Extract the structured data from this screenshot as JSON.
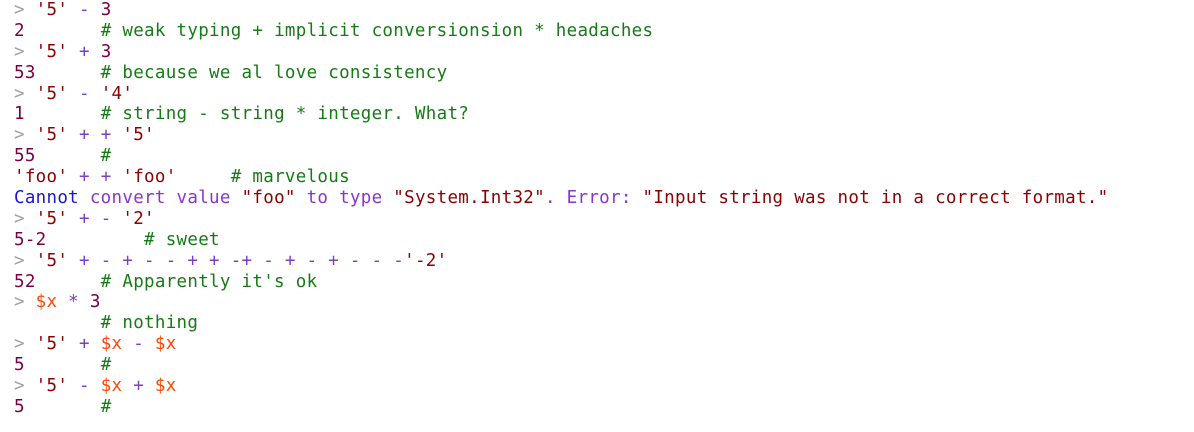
{
  "console": {
    "lines": [
      [
        {
          "t": "> ",
          "c": "prompt"
        },
        {
          "t": "'5'",
          "c": "str"
        },
        {
          "t": " - ",
          "c": "op"
        },
        {
          "t": "3",
          "c": "num"
        }
      ],
      [
        {
          "t": "2",
          "c": "num"
        },
        {
          "t": "       # weak typing + implicit conversionsion * headaches",
          "c": "cmt"
        }
      ],
      [
        {
          "t": "> ",
          "c": "prompt"
        },
        {
          "t": "'5'",
          "c": "str"
        },
        {
          "t": " + ",
          "c": "op"
        },
        {
          "t": "3",
          "c": "num"
        }
      ],
      [
        {
          "t": "53",
          "c": "num"
        },
        {
          "t": "      # because we al love consistency",
          "c": "cmt"
        }
      ],
      [
        {
          "t": "> ",
          "c": "prompt"
        },
        {
          "t": "'5'",
          "c": "str"
        },
        {
          "t": " - ",
          "c": "op"
        },
        {
          "t": "'4'",
          "c": "str"
        }
      ],
      [
        {
          "t": "1",
          "c": "num"
        },
        {
          "t": "       # string - string * integer. What?",
          "c": "cmt"
        }
      ],
      [
        {
          "t": "> ",
          "c": "prompt"
        },
        {
          "t": "'5'",
          "c": "str"
        },
        {
          "t": " + + ",
          "c": "op"
        },
        {
          "t": "'5'",
          "c": "str"
        }
      ],
      [
        {
          "t": "55",
          "c": "num"
        },
        {
          "t": "      #",
          "c": "cmt"
        }
      ],
      [
        {
          "t": "'foo'",
          "c": "str"
        },
        {
          "t": " + + ",
          "c": "op"
        },
        {
          "t": "'foo'",
          "c": "str"
        },
        {
          "t": "     # marvelous",
          "c": "cmt"
        }
      ],
      [
        {
          "t": "Cannot",
          "c": "kw"
        },
        {
          "t": " convert value ",
          "c": "errkey"
        },
        {
          "t": "\"foo\"",
          "c": "str"
        },
        {
          "t": " to type ",
          "c": "errkey"
        },
        {
          "t": "\"System.Int32\"",
          "c": "str"
        },
        {
          "t": ". Error: ",
          "c": "errkey"
        },
        {
          "t": "\"Input string was not in a correct format.\"",
          "c": "str"
        }
      ],
      [
        {
          "t": "> ",
          "c": "prompt"
        },
        {
          "t": "'5'",
          "c": "str"
        },
        {
          "t": " + - ",
          "c": "op"
        },
        {
          "t": "'2'",
          "c": "str"
        }
      ],
      [
        {
          "t": "5-2",
          "c": "num"
        },
        {
          "t": "         # sweet",
          "c": "cmt"
        }
      ],
      [
        {
          "t": "> ",
          "c": "prompt"
        },
        {
          "t": "'5'",
          "c": "str"
        },
        {
          "t": " + - + - - + + -+ - + - + - - -",
          "c": "op"
        },
        {
          "t": "'-2'",
          "c": "str"
        }
      ],
      [
        {
          "t": "52",
          "c": "num"
        },
        {
          "t": "      # Apparently it's ok",
          "c": "cmt"
        }
      ],
      [
        {
          "t": "> ",
          "c": "prompt"
        },
        {
          "t": "$x",
          "c": "var"
        },
        {
          "t": " * ",
          "c": "op"
        },
        {
          "t": "3",
          "c": "num"
        }
      ],
      [
        {
          "t": "        # nothing",
          "c": "cmt"
        }
      ],
      [
        {
          "t": "> ",
          "c": "prompt"
        },
        {
          "t": "'5'",
          "c": "str"
        },
        {
          "t": " + ",
          "c": "op"
        },
        {
          "t": "$x",
          "c": "var"
        },
        {
          "t": " - ",
          "c": "op"
        },
        {
          "t": "$x",
          "c": "var"
        }
      ],
      [
        {
          "t": "5",
          "c": "num"
        },
        {
          "t": "       #",
          "c": "cmt"
        }
      ],
      [
        {
          "t": "> ",
          "c": "prompt"
        },
        {
          "t": "'5'",
          "c": "str"
        },
        {
          "t": " - ",
          "c": "op"
        },
        {
          "t": "$x",
          "c": "var"
        },
        {
          "t": " + ",
          "c": "op"
        },
        {
          "t": "$x",
          "c": "var"
        }
      ],
      [
        {
          "t": "5",
          "c": "num"
        },
        {
          "t": "       #",
          "c": "cmt"
        }
      ]
    ]
  }
}
